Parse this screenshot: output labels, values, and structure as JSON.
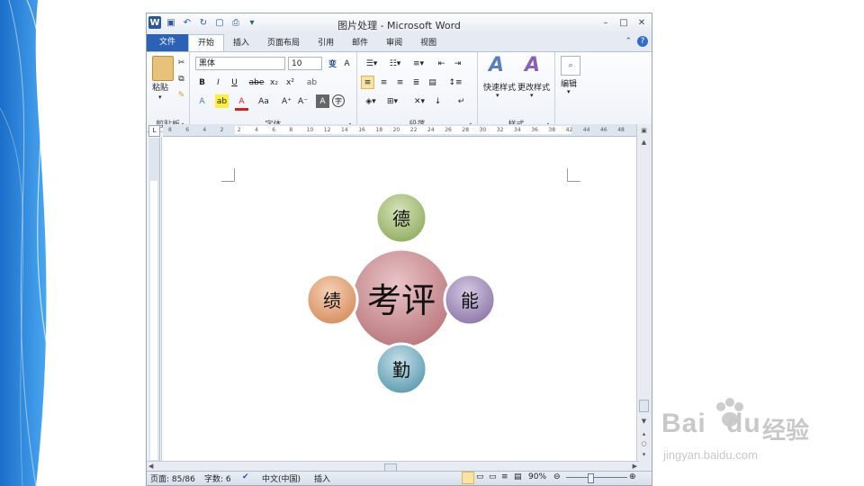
{
  "window": {
    "logo": "W",
    "title": "图片处理 - Microsoft Word",
    "controls": [
      "–",
      "□",
      "✕"
    ]
  },
  "tabs": [
    {
      "label": "文件"
    },
    {
      "label": "开始"
    },
    {
      "label": "插入"
    },
    {
      "label": "页面布局"
    },
    {
      "label": "引用"
    },
    {
      "label": "邮件"
    },
    {
      "label": "审阅"
    },
    {
      "label": "视图"
    }
  ],
  "ribbon": {
    "clipboard": {
      "paste": "粘贴",
      "label": "剪贴板"
    },
    "font": {
      "name": "黑体",
      "size": "10",
      "label": "字体",
      "bold": "B",
      "italic": "I",
      "underline": "U",
      "strike": "abe",
      "sub": "x₂",
      "sup": "x²",
      "grow": "A⁺",
      "shrink": "A⁻",
      "aa": "Aa"
    },
    "paragraph": {
      "label": "段落"
    },
    "styles": {
      "quick": "快速样式",
      "change": "更改样式",
      "label": "样式"
    },
    "editing": {
      "label": "编辑"
    }
  },
  "ruler": {
    "ticks": [
      "8",
      "6",
      "4",
      "2",
      "2",
      "4",
      "6",
      "8",
      "10",
      "12",
      "14",
      "16",
      "18",
      "20",
      "22",
      "24",
      "26",
      "28",
      "30",
      "32",
      "34",
      "36",
      "38",
      "42",
      "44",
      "46",
      "48"
    ]
  },
  "diagram": {
    "center": "考评",
    "top": "德",
    "right": "能",
    "bottom": "勤",
    "left": "绩"
  },
  "status": {
    "page": "页面: 85/86",
    "words": "字数: 6",
    "lang": "中文(中国)",
    "mode": "插入",
    "zoom": "90%"
  },
  "watermark": {
    "brand": "Bai",
    "brand2": "du",
    "cn": "经验",
    "url": "jingyan.baidu.com"
  },
  "colors": {
    "accent": "#2b579a",
    "center_circle": "#c98a8f",
    "top_circle": "#a8bf7a",
    "right_circle": "#a08bb8",
    "bottom_circle": "#76aec0",
    "left_circle": "#e3a37a"
  }
}
